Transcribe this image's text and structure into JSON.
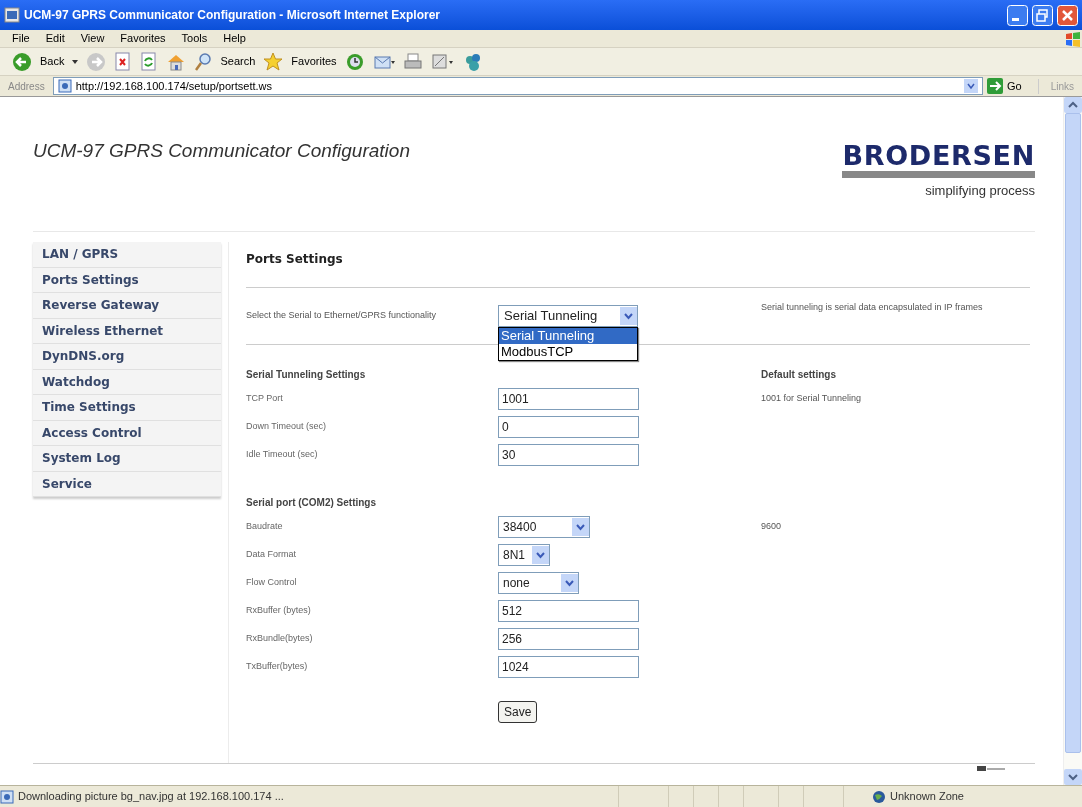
{
  "window": {
    "title": "UCM-97 GPRS Communicator Configuration - Microsoft Internet Explorer"
  },
  "menu": [
    "File",
    "Edit",
    "View",
    "Favorites",
    "Tools",
    "Help"
  ],
  "toolbar": {
    "back": "Back",
    "search": "Search",
    "favorites": "Favorites"
  },
  "address": {
    "label": "Address",
    "url": "http://192.168.100.174/setup/portsett.ws",
    "go": "Go",
    "links": "Links"
  },
  "page": {
    "heading": "UCM-97 GPRS Communicator Configuration",
    "logo": {
      "name": "BRODERSEN",
      "tagline": "simplifying process"
    }
  },
  "sidebar": {
    "items": [
      "LAN / GPRS",
      "Ports Settings",
      "Reverse Gateway",
      "Wireless Ethernet",
      "DynDNS.org",
      "Watchdog",
      "Time Settings",
      "Access Control",
      "System Log",
      "Service"
    ]
  },
  "content": {
    "title": "Ports Settings",
    "functionality": {
      "label": "Select the Serial to Ethernet/GPRS functionality",
      "value": "Serial Tunneling",
      "options": [
        {
          "label": "Serial Tunneling",
          "selected": true
        },
        {
          "label": "ModbusTCP",
          "selected": false
        }
      ],
      "note": "Serial tunneling is serial data encapsulated in IP frames"
    },
    "sections": [
      {
        "title": "Serial Tunneling Settings",
        "aside": "Default settings",
        "rows": [
          {
            "label": "TCP Port",
            "kind": "text",
            "value": "1001",
            "default": "1001 for Serial Tunneling"
          },
          {
            "label": "Down Timeout (sec)",
            "kind": "text",
            "value": "0"
          },
          {
            "label": "Idle Timeout (sec)",
            "kind": "text",
            "value": "30"
          }
        ]
      },
      {
        "title": "Serial port (COM2) Settings",
        "rows": [
          {
            "label": "Baudrate",
            "kind": "select",
            "value": "38400",
            "default": "9600"
          },
          {
            "label": "Data Format",
            "kind": "select",
            "value": "8N1"
          },
          {
            "label": "Flow Control",
            "kind": "select",
            "value": "none"
          },
          {
            "label": "RxBuffer (bytes)",
            "kind": "text",
            "value": "512"
          },
          {
            "label": "RxBundle(bytes)",
            "kind": "text",
            "value": "256"
          },
          {
            "label": "TxBuffer(bytes)",
            "kind": "text",
            "value": "1024"
          }
        ]
      }
    ],
    "save": "Save"
  },
  "status_bar": {
    "text": "Downloading picture bg_nav.jpg at 192.168.100.174 ...",
    "zone": "Unknown Zone"
  }
}
